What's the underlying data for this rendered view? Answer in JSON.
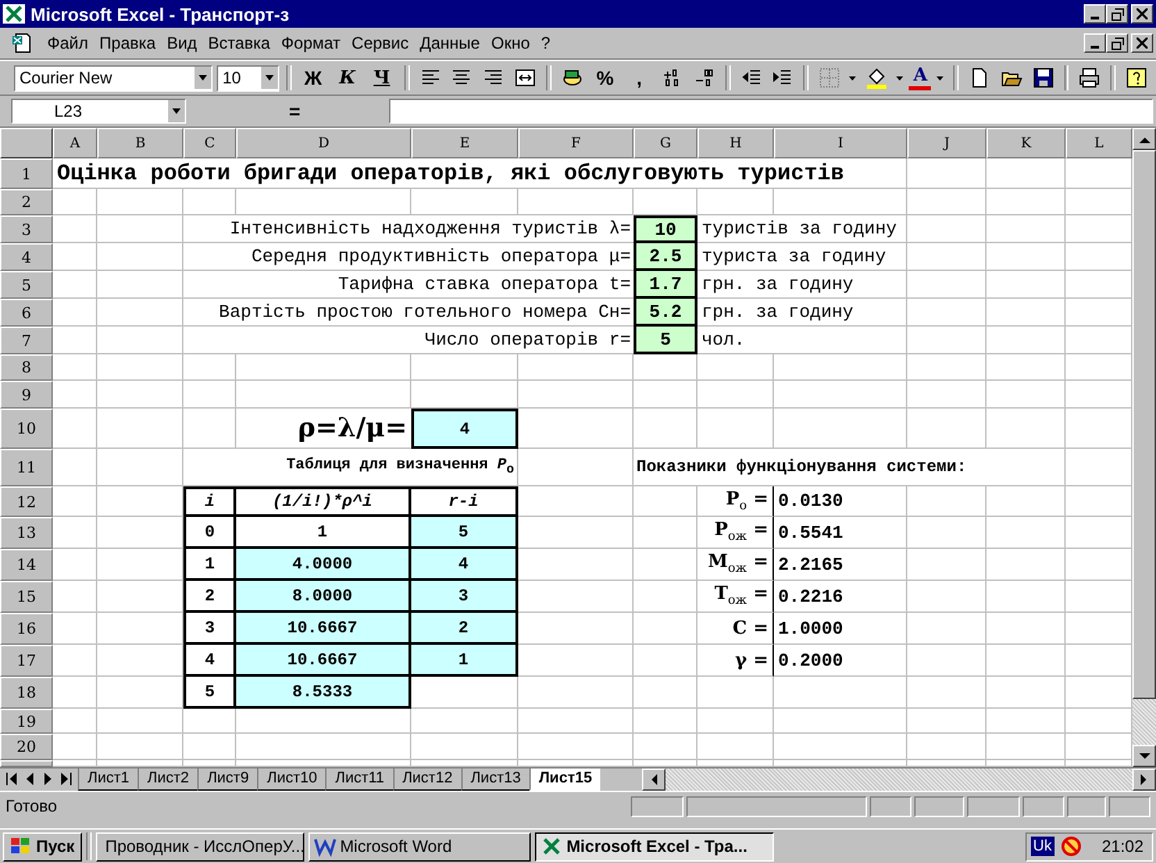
{
  "window": {
    "title": "Microsoft Excel - Транспорт-з"
  },
  "menu": [
    "Файл",
    "Правка",
    "Вид",
    "Вставка",
    "Формат",
    "Сервис",
    "Данные",
    "Окно",
    "?"
  ],
  "toolbar": {
    "font": "Courier New",
    "size": "10",
    "bold": "Ж",
    "italic": "К",
    "underline": "Ч",
    "percent": "%",
    "comma": ",",
    "font_color": "A"
  },
  "formula_bar": {
    "name_box": "L23",
    "equals": "="
  },
  "columns": [
    "A",
    "B",
    "C",
    "D",
    "E",
    "F",
    "G",
    "H",
    "I",
    "J",
    "K",
    "L"
  ],
  "rows": [
    "1",
    "2",
    "3",
    "4",
    "5",
    "6",
    "7",
    "8",
    "9",
    "10",
    "11",
    "12",
    "13",
    "14",
    "15",
    "16",
    "17",
    "18",
    "19",
    "20"
  ],
  "title": "Оцінка роботи бригади операторів, які обслуговують туристів",
  "parameters": [
    {
      "label": "Інтенсивність надходження туристів λ=",
      "value": "10",
      "unit": "туристів за годину"
    },
    {
      "label": "Середня продуктивність оператора μ=",
      "value": "2.5",
      "unit": "туриста за годину"
    },
    {
      "label": "Тарифна ставка оператора t=",
      "value": "1.7",
      "unit": "грн. за годину"
    },
    {
      "label": "Вартість простою готельного номера Сн=",
      "value": "5.2",
      "unit": "грн. за годину"
    },
    {
      "label": "Число операторів r=",
      "value": "5",
      "unit": "чол."
    }
  ],
  "rho": {
    "label": "ρ=λ/μ=",
    "value": "4"
  },
  "p0_table": {
    "title": "Таблиця для визначення *P*$_{о}$",
    "columns": [
      "i",
      "(1/i!)*ρ^i",
      "r-i"
    ],
    "rows": [
      {
        "i": "0",
        "term": "1",
        "term_shaded": false,
        "r_minus_i": "5"
      },
      {
        "i": "1",
        "term": "4.0000",
        "term_shaded": true,
        "r_minus_i": "4"
      },
      {
        "i": "2",
        "term": "8.0000",
        "term_shaded": true,
        "r_minus_i": "3"
      },
      {
        "i": "3",
        "term": "10.6667",
        "term_shaded": true,
        "r_minus_i": "2"
      },
      {
        "i": "4",
        "term": "10.6667",
        "term_shaded": true,
        "r_minus_i": "1"
      },
      {
        "i": "5",
        "term": "8.5333",
        "term_shaded": true
      }
    ]
  },
  "indicators": {
    "title": "Показники функціонування системи:",
    "items": [
      {
        "label": "P$_{о}$ =",
        "value": "0.0130"
      },
      {
        "label": "P$_{ож}$ =",
        "value": "0.5541"
      },
      {
        "label": "M$_{ож}$ =",
        "value": "2.2165"
      },
      {
        "label": "T$_{ож}$ =",
        "value": "0.2216"
      },
      {
        "label": "C =",
        "value": "1.0000"
      },
      {
        "label": "γ =",
        "value": "0.2000"
      }
    ]
  },
  "sheet_tabs": [
    {
      "label": "Лист1",
      "selected": false
    },
    {
      "label": "Лист2",
      "selected": false
    },
    {
      "label": "Лист9",
      "selected": false
    },
    {
      "label": "Лист10",
      "selected": false
    },
    {
      "label": "Лист11",
      "selected": false
    },
    {
      "label": "Лист12",
      "selected": false
    },
    {
      "label": "Лист13",
      "selected": false
    },
    {
      "label": "Лист15",
      "selected": true
    }
  ],
  "status": "Готово",
  "taskbar": {
    "start": "Пуск",
    "tasks": [
      {
        "label": "Проводник - ИсслОперУ...",
        "selected": false,
        "kind": "explorer"
      },
      {
        "label": "Microsoft Word",
        "selected": false,
        "kind": "word"
      },
      {
        "label": "Microsoft Excel - Тра...",
        "selected": true,
        "kind": "excel"
      }
    ],
    "language": "Uk",
    "clock": "21:02"
  }
}
